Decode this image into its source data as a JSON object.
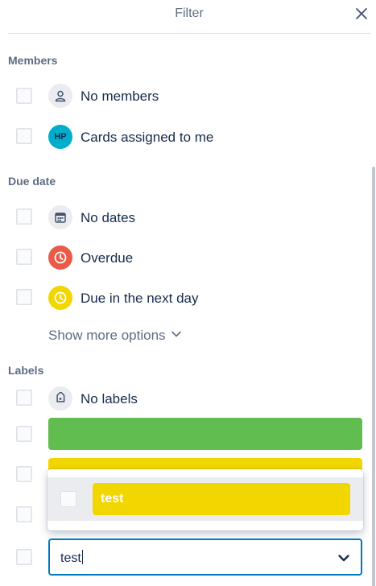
{
  "header": {
    "title": "Filter"
  },
  "members": {
    "title": "Members",
    "items": [
      {
        "label": "No members",
        "icon": "person-icon"
      },
      {
        "label": "Cards assigned to me",
        "avatar_initials": "HP",
        "avatar_color": "#00aecc"
      }
    ]
  },
  "due_date": {
    "title": "Due date",
    "items": [
      {
        "label": "No dates",
        "icon": "calendar-icon"
      },
      {
        "label": "Overdue",
        "icon": "clock-icon",
        "color": "#eb5a46"
      },
      {
        "label": "Due in the next day",
        "icon": "clock-icon",
        "color": "#f2d600"
      }
    ],
    "show_more": "Show more options"
  },
  "labels": {
    "title": "Labels",
    "no_labels": "No labels",
    "label_colors": [
      "#61bd4f",
      "#f2d600"
    ]
  },
  "dropdown": {
    "options": [
      {
        "name": "test",
        "color": "#f2d600"
      }
    ]
  },
  "label_select": {
    "value": "test"
  }
}
